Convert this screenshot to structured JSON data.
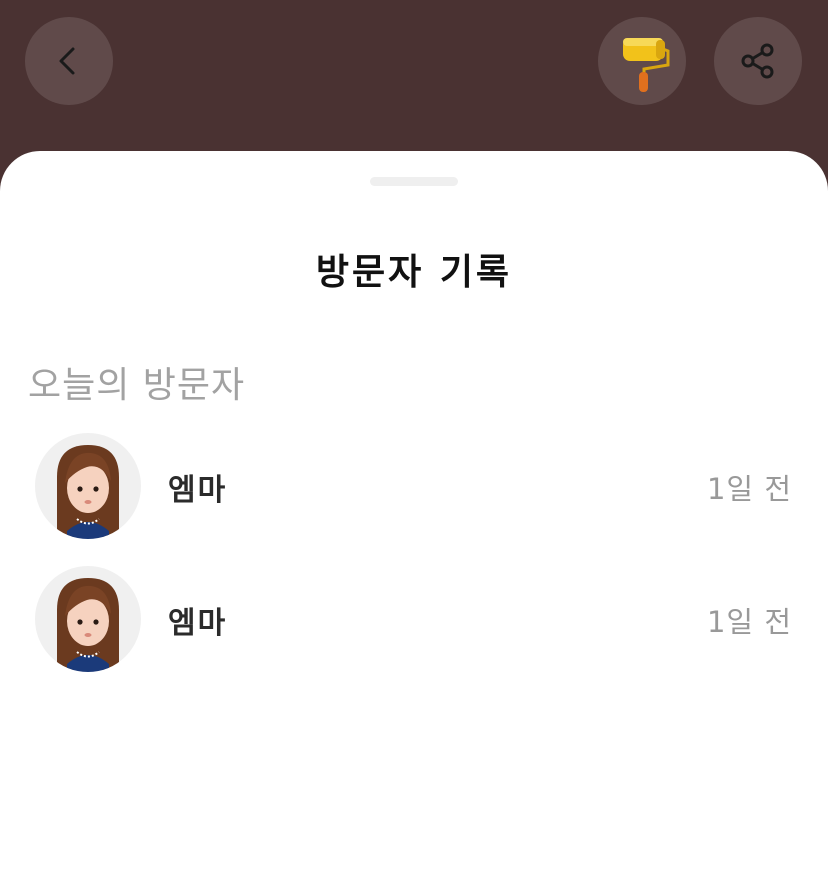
{
  "header": {
    "back_icon": "chevron-left-icon",
    "theme_icon": "paint-roller-icon",
    "share_icon": "share-icon"
  },
  "sheet": {
    "title": "방문자 기록",
    "section_title": "오늘의 방문자",
    "visitors": [
      {
        "name": "엠마",
        "time": "1일 전"
      },
      {
        "name": "엠마",
        "time": "1일 전"
      }
    ]
  },
  "colors": {
    "header_background": "#4a3232",
    "sheet_background": "#ffffff",
    "muted_text": "#a2a2a2",
    "avatar_dress": "#1b3a7a",
    "roller_yellow": "#f2c21a",
    "roller_handle": "#e0701e"
  }
}
